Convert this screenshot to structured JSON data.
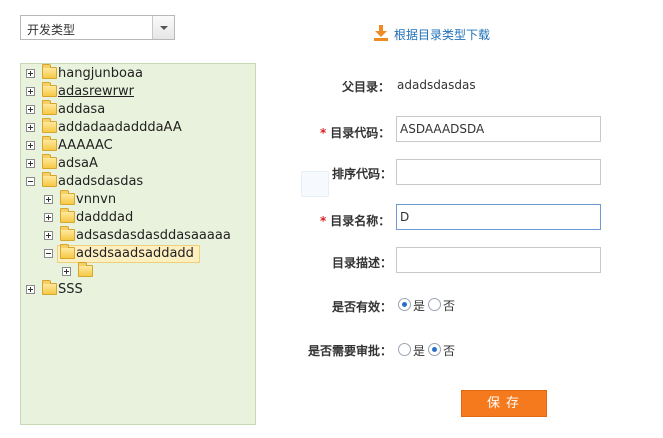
{
  "type_select": {
    "value": "开发类型"
  },
  "download_link": {
    "label": "根据目录类型下载"
  },
  "tree": {
    "nodes": [
      {
        "label": "hangjunboaa"
      },
      {
        "label": "adasrewrwr"
      },
      {
        "label": "addasa"
      },
      {
        "label": "addadaadadddaAA"
      },
      {
        "label": "AAAAAC"
      },
      {
        "label": "adsaA"
      },
      {
        "label": "adadsdasdas"
      },
      {
        "label": "vnnvn"
      },
      {
        "label": "dadddad"
      },
      {
        "label": "adsasdasdasddasaaaaa"
      },
      {
        "label": "adsdsaadsaddadd"
      },
      {
        "label": ""
      },
      {
        "label": "SSS"
      }
    ]
  },
  "form": {
    "parent_label": "父目录：",
    "parent_value": "adadsdasdas",
    "code_label": "目录代码：",
    "code_value": "ASDAAADSDA",
    "sort_label": "排序代码：",
    "sort_value": "",
    "name_label": "目录名称：",
    "name_value": "D",
    "desc_label": "目录描述：",
    "desc_value": "",
    "valid_label": "是否有效：",
    "valid_yes": "是",
    "valid_no": "否",
    "valid_selected": "是",
    "approve_label": "是否需要审批：",
    "approve_yes": "是",
    "approve_no": "否",
    "approve_selected": "否",
    "required_mark": "*",
    "save_label": "保存"
  },
  "colors": {
    "accent": "#f57a1e",
    "tree_bg": "#e9f2dc",
    "link": "#1e6fb8"
  }
}
